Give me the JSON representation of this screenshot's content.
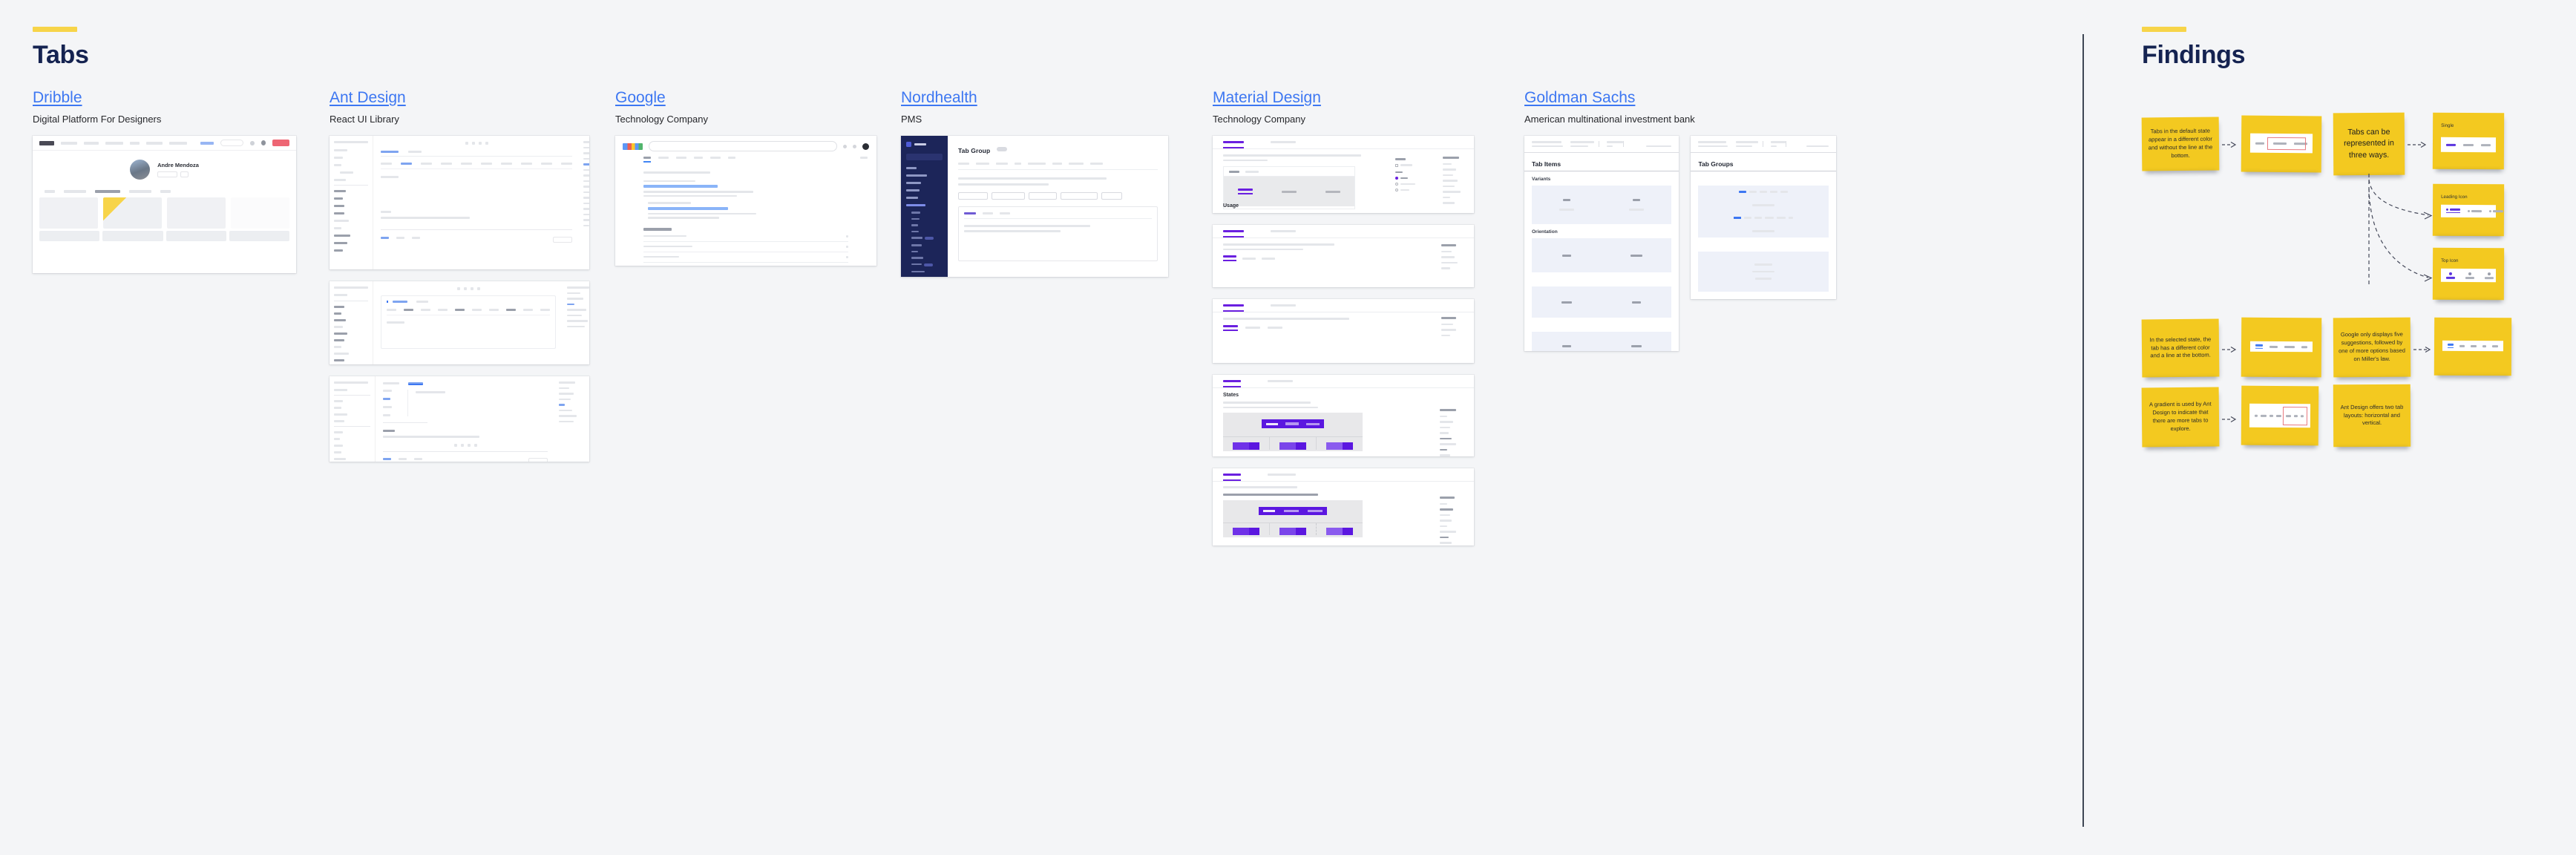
{
  "left": {
    "title": "Tabs",
    "accent_color": "#f7d449",
    "title_color": "#152351",
    "columns": [
      {
        "link": "Dribble",
        "subtitle": "Digital Platform For Designers"
      },
      {
        "link": "Ant Design",
        "subtitle": "React UI Library"
      },
      {
        "link": "Google",
        "subtitle": "Technology Company"
      },
      {
        "link": "Nordhealth",
        "subtitle": "PMS"
      },
      {
        "link": "Material Design",
        "subtitle": "Technology Company"
      },
      {
        "link": "Goldman Sachs",
        "subtitle": "American multinational investment bank"
      }
    ],
    "shots": {
      "dribble_profile_name": "Andre Mendoza",
      "nordhealth_title": "Tab Group",
      "material_usage_heading": "Usage",
      "material_states_heading": "States",
      "goldman_tab_items_heading": "Tab Items",
      "goldman_tab_groups_heading": "Tab Groups",
      "goldman_variants_label": "Variants",
      "goldman_orientation_label": "Orientation"
    }
  },
  "findings": {
    "title": "Findings",
    "accent_color": "#f7d449",
    "title_color": "#152351",
    "notes": [
      {
        "id": "note-default-state",
        "text": "Tabs in the default state appear in a different color and without the line at the bottom."
      },
      {
        "id": "note-default-state-example",
        "text": ""
      },
      {
        "id": "note-three-ways",
        "text": "Tabs can be represented in three ways."
      },
      {
        "id": "note-single",
        "label": "Single"
      },
      {
        "id": "note-leading-icon",
        "label": "Leading Icon"
      },
      {
        "id": "note-top-icon",
        "label": "Top Icon"
      },
      {
        "id": "note-selected-state",
        "text": "In the selected state, the tab has a different color and a line at the bottom."
      },
      {
        "id": "note-selected-state-example",
        "text": ""
      },
      {
        "id": "note-miller-law",
        "text": "Google only displays five suggestions, followed by one of more options based on Miller's law."
      },
      {
        "id": "note-miller-law-example",
        "text": ""
      },
      {
        "id": "note-gradient",
        "text": "A gradient is used by Ant Design to indicate that there are more tabs to explore."
      },
      {
        "id": "note-gradient-example",
        "text": ""
      },
      {
        "id": "note-ant-layouts",
        "text": "Ant Design offers two tab layouts: horizontal and vertical."
      }
    ]
  },
  "colors": {
    "canvas": "#f4f5f7",
    "link": "#3d77f2",
    "sticky": "#f3c920",
    "divider": "#3e4654",
    "material_purple": "#6a1fe0",
    "nordhealth_navy": "#1c2559"
  }
}
